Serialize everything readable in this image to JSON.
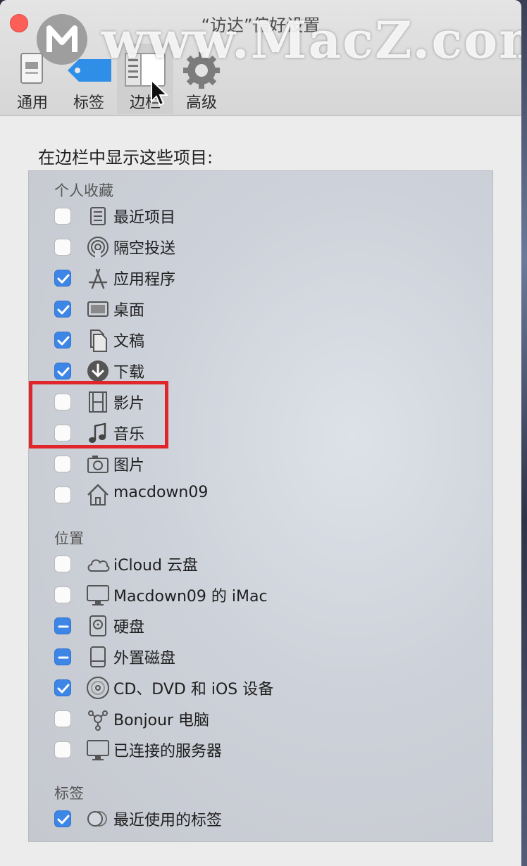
{
  "window": {
    "title": "“访达”偏好设置",
    "watermark": "www.MacZ.com",
    "tabs": [
      {
        "label": "通用",
        "icon": "general-icon",
        "selected": false
      },
      {
        "label": "标签",
        "icon": "tag-icon",
        "selected": false
      },
      {
        "label": "边栏",
        "icon": "sidebar-icon",
        "selected": true
      },
      {
        "label": "高级",
        "icon": "gear-icon",
        "selected": false
      }
    ]
  },
  "content": {
    "heading": "在边栏中显示这些项目:",
    "groups": [
      {
        "title": "个人收藏",
        "items": [
          {
            "label": "最近项目",
            "state": "unchecked",
            "icon": "recents-icon"
          },
          {
            "label": "隔空投送",
            "state": "unchecked",
            "icon": "airdrop-icon"
          },
          {
            "label": "应用程序",
            "state": "checked",
            "icon": "applications-icon"
          },
          {
            "label": "桌面",
            "state": "checked",
            "icon": "desktop-icon"
          },
          {
            "label": "文稿",
            "state": "checked",
            "icon": "documents-icon"
          },
          {
            "label": "下载",
            "state": "checked",
            "icon": "downloads-icon"
          },
          {
            "label": "影片",
            "state": "unchecked",
            "icon": "movies-icon"
          },
          {
            "label": "音乐",
            "state": "unchecked",
            "icon": "music-icon"
          },
          {
            "label": "图片",
            "state": "unchecked",
            "icon": "pictures-icon"
          },
          {
            "label": "macdown09",
            "state": "unchecked",
            "icon": "home-icon"
          }
        ]
      },
      {
        "title": "位置",
        "items": [
          {
            "label": "iCloud 云盘",
            "state": "unchecked",
            "icon": "icloud-icon"
          },
          {
            "label": "Macdown09 的 iMac",
            "state": "unchecked",
            "icon": "imac-icon"
          },
          {
            "label": "硬盘",
            "state": "mixed",
            "icon": "hard-disk-icon"
          },
          {
            "label": "外置磁盘",
            "state": "mixed",
            "icon": "external-disk-icon"
          },
          {
            "label": "CD、DVD 和 iOS 设备",
            "state": "checked",
            "icon": "optical-disc-icon"
          },
          {
            "label": "Bonjour 电脑",
            "state": "unchecked",
            "icon": "bonjour-icon"
          },
          {
            "label": "已连接的服务器",
            "state": "unchecked",
            "icon": "server-icon"
          }
        ]
      },
      {
        "title": "标签",
        "items": [
          {
            "label": "最近使用的标签",
            "state": "checked",
            "icon": "tags-icon"
          }
        ]
      }
    ]
  },
  "colors": {
    "accent": "#3d86e6",
    "highlight_box": "#e0262a",
    "close_button": "#fb5f57"
  }
}
